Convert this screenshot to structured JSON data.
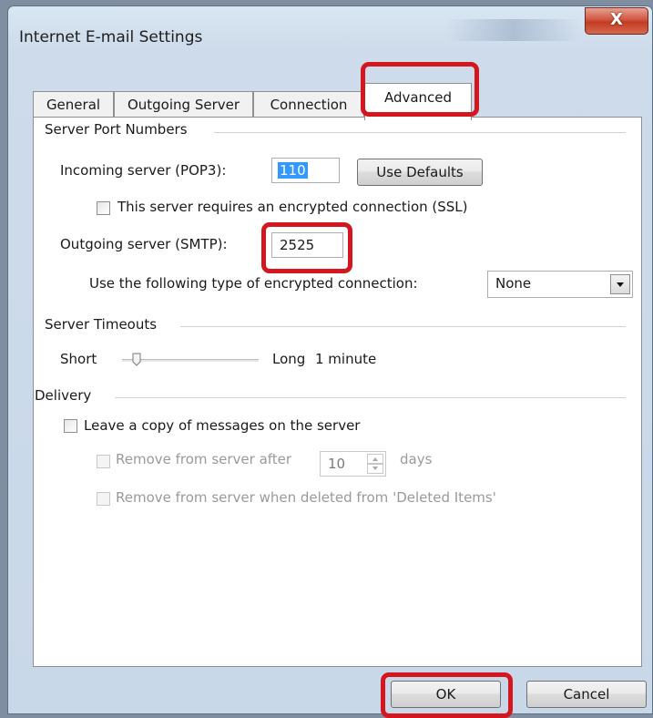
{
  "window": {
    "title": "Internet E-mail Settings",
    "close_glyph": "X"
  },
  "tabs": [
    {
      "label": "General"
    },
    {
      "label": "Outgoing Server"
    },
    {
      "label": "Connection"
    },
    {
      "label": "Advanced",
      "active": true
    }
  ],
  "server_ports": {
    "group_label": "Server Port Numbers",
    "incoming_label": "Incoming server (POP3):",
    "incoming_value": "110",
    "use_defaults_label": "Use Defaults",
    "ssl_label": "This server requires an encrypted connection (SSL)",
    "ssl_checked": false,
    "outgoing_label": "Outgoing server (SMTP):",
    "outgoing_value": "2525",
    "encryption_label": "Use the following type of encrypted connection:",
    "encryption_value": "None"
  },
  "timeouts": {
    "group_label": "Server Timeouts",
    "short_label": "Short",
    "long_label": "Long",
    "value_label": "1 minute",
    "slider_level": 0.1
  },
  "delivery": {
    "group_label": "Delivery",
    "leave_copy_label": "Leave a copy of messages on the server",
    "leave_copy_checked": false,
    "remove_after_label": "Remove from server after",
    "remove_after_value": "10",
    "days_label": "days",
    "remove_deleted_label": "Remove from server when deleted from 'Deleted Items'"
  },
  "footer": {
    "ok_label": "OK",
    "cancel_label": "Cancel"
  },
  "colors": {
    "callout": "#d4161f",
    "selection": "#3399ff",
    "close": "#c23b22"
  },
  "icons": [
    "close-icon",
    "dropdown-arrow-icon",
    "spinner-up-icon",
    "spinner-down-icon",
    "slider-thumb-icon"
  ]
}
